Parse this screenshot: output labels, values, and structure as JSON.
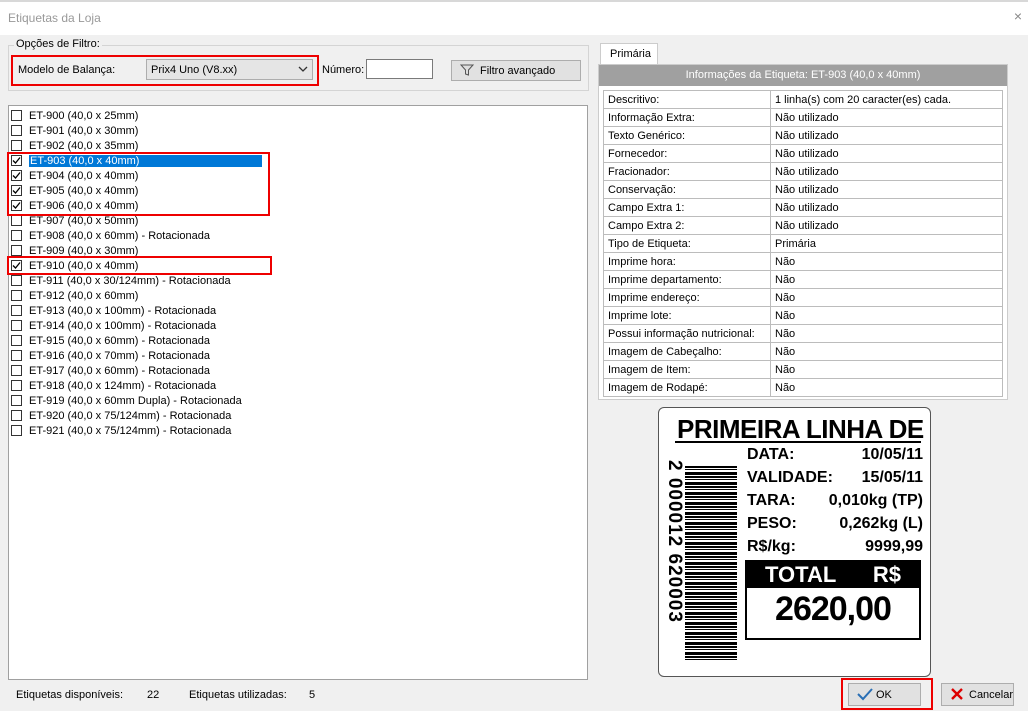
{
  "window": {
    "title": "Etiquetas da Loja",
    "close_glyph": "×"
  },
  "filter": {
    "legend": "Opções de Filtro:",
    "scale_label": "Modelo de Balança:",
    "scale_value": "Prix4 Uno (V8.xx)",
    "numero_label": "Número:",
    "numero_value": "",
    "advanced_button": "Filtro avançado"
  },
  "labels": [
    {
      "text": "ET-900 (40,0 x 25mm)",
      "checked": false,
      "selected": false
    },
    {
      "text": "ET-901 (40,0 x 30mm)",
      "checked": false,
      "selected": false
    },
    {
      "text": "ET-902 (40,0 x 35mm)",
      "checked": false,
      "selected": false
    },
    {
      "text": "ET-903 (40,0 x 40mm)",
      "checked": true,
      "selected": true
    },
    {
      "text": "ET-904 (40,0 x 40mm)",
      "checked": true,
      "selected": false
    },
    {
      "text": "ET-905 (40,0 x 40mm)",
      "checked": true,
      "selected": false
    },
    {
      "text": "ET-906 (40,0 x 40mm)",
      "checked": true,
      "selected": false
    },
    {
      "text": "ET-907 (40,0 x 50mm)",
      "checked": false,
      "selected": false
    },
    {
      "text": "ET-908 (40,0 x 60mm) - Rotacionada",
      "checked": false,
      "selected": false
    },
    {
      "text": "ET-909 (40,0 x 30mm)",
      "checked": false,
      "selected": false
    },
    {
      "text": "ET-910 (40,0 x 40mm)",
      "checked": true,
      "selected": false
    },
    {
      "text": "ET-911 (40,0 x 30/124mm) - Rotacionada",
      "checked": false,
      "selected": false
    },
    {
      "text": "ET-912 (40,0 x 60mm)",
      "checked": false,
      "selected": false
    },
    {
      "text": "ET-913 (40,0 x 100mm) - Rotacionada",
      "checked": false,
      "selected": false
    },
    {
      "text": "ET-914 (40,0 x 100mm) - Rotacionada",
      "checked": false,
      "selected": false
    },
    {
      "text": "ET-915 (40,0 x 60mm) - Rotacionada",
      "checked": false,
      "selected": false
    },
    {
      "text": "ET-916 (40,0 x 70mm) - Rotacionada",
      "checked": false,
      "selected": false
    },
    {
      "text": "ET-917 (40,0 x 60mm) - Rotacionada",
      "checked": false,
      "selected": false
    },
    {
      "text": "ET-918 (40,0 x 124mm) - Rotacionada",
      "checked": false,
      "selected": false
    },
    {
      "text": "ET-919 (40,0 x 60mm Dupla) - Rotacionada",
      "checked": false,
      "selected": false
    },
    {
      "text": "ET-920 (40,0 x 75/124mm) - Rotacionada",
      "checked": false,
      "selected": false
    },
    {
      "text": "ET-921 (40,0 x 75/124mm) - Rotacionada",
      "checked": false,
      "selected": false
    }
  ],
  "info": {
    "tab": "Primária",
    "header": "Informações da Etiqueta: ET-903 (40,0 x 40mm)",
    "rows": [
      [
        "Descritivo:",
        "1  linha(s) com 20  caracter(es) cada."
      ],
      [
        "Informação Extra:",
        "Não utilizado"
      ],
      [
        "Texto Genérico:",
        "Não utilizado"
      ],
      [
        "Fornecedor:",
        "Não utilizado"
      ],
      [
        "Fracionador:",
        "Não utilizado"
      ],
      [
        "Conservação:",
        "Não utilizado"
      ],
      [
        "Campo Extra 1:",
        "Não utilizado"
      ],
      [
        "Campo Extra 2:",
        "Não utilizado"
      ],
      [
        "Tipo de Etiqueta:",
        "Primária"
      ],
      [
        "Imprime hora:",
        "Não"
      ],
      [
        "Imprime departamento:",
        "Não"
      ],
      [
        "Imprime endereço:",
        "Não"
      ],
      [
        "Imprime lote:",
        "Não"
      ],
      [
        "Possui informação nutricional:",
        "Não"
      ],
      [
        "Imagem de Cabeçalho:",
        "Não"
      ],
      [
        "Imagem de Item:",
        "Não"
      ],
      [
        "Imagem de Rodapé:",
        "Não"
      ]
    ]
  },
  "preview": {
    "title": "PRIMEIRA LINHA DE DE",
    "fields": [
      [
        "DATA:",
        "10/05/11"
      ],
      [
        "VALIDADE:",
        "15/05/11"
      ],
      [
        "TARA:",
        "0,010kg (TP)"
      ],
      [
        "PESO:",
        "0,262kg (L)"
      ],
      [
        "R$/kg:",
        "9999,99"
      ]
    ],
    "total_label": "TOTAL",
    "total_currency": "R$",
    "total_value": "2620,00",
    "ean": "2 000012 620003"
  },
  "footer": {
    "available_label": "Etiquetas disponíveis:",
    "available_value": "22",
    "used_label": "Etiquetas utilizadas:",
    "used_value": "5",
    "ok_label": "OK",
    "cancel_label": "Cancelar"
  },
  "colors": {
    "selection": "#0078d7",
    "annotation": "#ee0000",
    "info_header": "#a0a0a0"
  }
}
